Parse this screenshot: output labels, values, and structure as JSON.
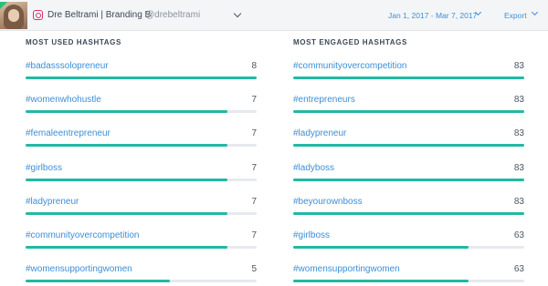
{
  "header": {
    "account_name": "Dre Beltrami | Branding B",
    "account_handle": "@drebeltrami",
    "date_range": "Jan 1, 2017 - Mar 7, 2017",
    "export_label": "Export"
  },
  "colors": {
    "link": "#3b8fd9",
    "bar_fill": "#22b8a4",
    "bar_track": "#e6e9ed",
    "instagram": "#d6336c"
  },
  "most_used": {
    "title": "MOST USED HASHTAGS",
    "items": [
      {
        "tag": "#badasssolopreneur",
        "count": "8",
        "level": 1.0
      },
      {
        "tag": "#womenwhohustle",
        "count": "7",
        "level": 0.875
      },
      {
        "tag": "#femaleentrepreneur",
        "count": "7",
        "level": 0.875
      },
      {
        "tag": "#girlboss",
        "count": "7",
        "level": 0.875
      },
      {
        "tag": "#ladypreneur",
        "count": "7",
        "level": 0.875
      },
      {
        "tag": "#communityovercompetition",
        "count": "7",
        "level": 0.875
      },
      {
        "tag": "#womensupportingwomen",
        "count": "5",
        "level": 0.625
      }
    ]
  },
  "most_engaged": {
    "title": "MOST ENGAGED HASHTAGS",
    "items": [
      {
        "tag": "#communityovercompetition",
        "count": "83",
        "level": 1.0
      },
      {
        "tag": "#entrepreneurs",
        "count": "83",
        "level": 1.0
      },
      {
        "tag": "#ladypreneur",
        "count": "83",
        "level": 1.0
      },
      {
        "tag": "#ladyboss",
        "count": "83",
        "level": 1.0
      },
      {
        "tag": "#beyourownboss",
        "count": "83",
        "level": 1.0
      },
      {
        "tag": "#girlboss",
        "count": "63",
        "level": 0.76
      },
      {
        "tag": "#womensupportingwomen",
        "count": "63",
        "level": 0.76
      }
    ]
  }
}
